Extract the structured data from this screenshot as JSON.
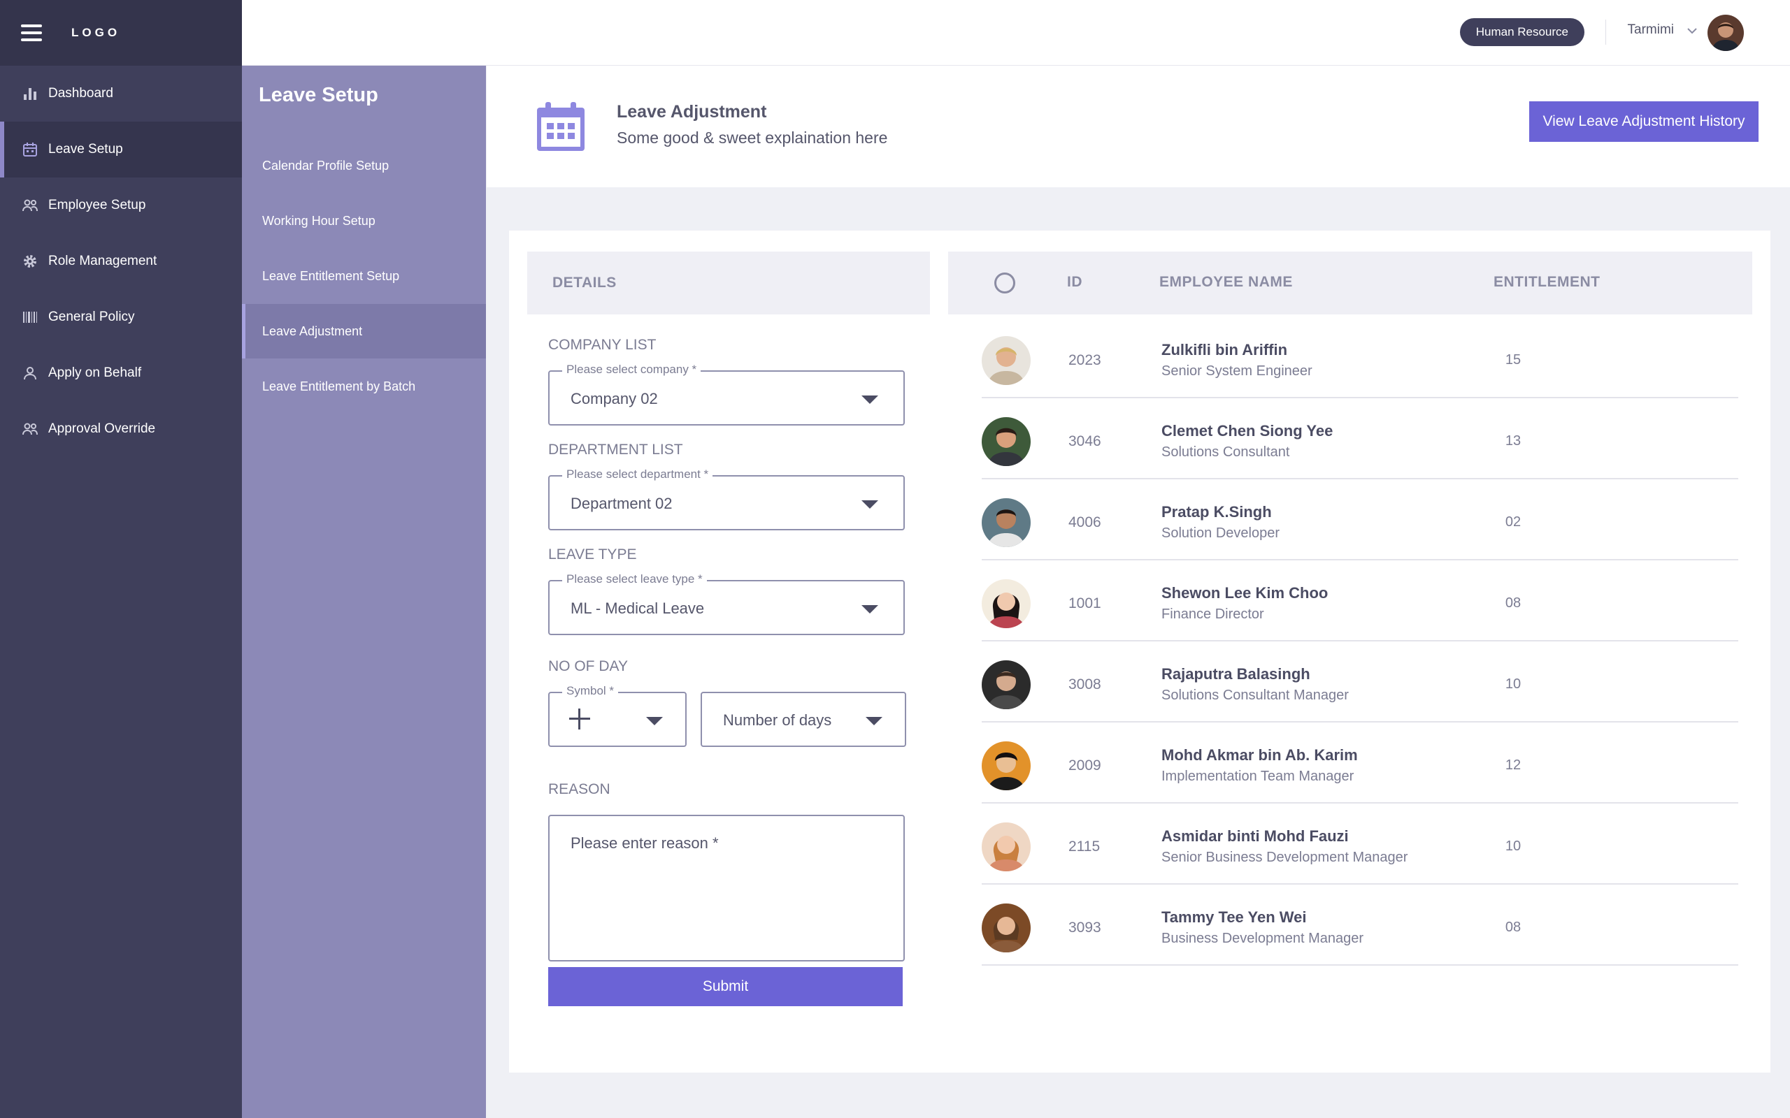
{
  "app": {
    "logo": "LOGO"
  },
  "sidebar": {
    "items": [
      {
        "label": "Dashboard",
        "icon": "bar-chart-icon"
      },
      {
        "label": "Leave Setup",
        "icon": "calendar-icon",
        "active": true
      },
      {
        "label": "Employee Setup",
        "icon": "users-icon"
      },
      {
        "label": "Role Management",
        "icon": "gear-icon"
      },
      {
        "label": "General Policy",
        "icon": "barcode-icon"
      },
      {
        "label": "Apply on Behalf",
        "icon": "user-icon"
      },
      {
        "label": "Approval Override",
        "icon": "users-icon"
      }
    ]
  },
  "subsidebar": {
    "title": "Leave Setup",
    "items": [
      {
        "label": "Calendar Profile Setup"
      },
      {
        "label": "Working Hour Setup"
      },
      {
        "label": "Leave Entitlement Setup"
      },
      {
        "label": "Leave Adjustment",
        "active": true
      },
      {
        "label": "Leave Entitlement by Batch"
      }
    ]
  },
  "header": {
    "role_badge": "Human Resource",
    "user_name": "Tarmimi"
  },
  "page": {
    "title": "Leave Adjustment",
    "subtitle": "Some good & sweet explaination here",
    "history_button": "View Leave Adjustment History"
  },
  "form": {
    "heading": "DETAILS",
    "company": {
      "section": "COMPANY LIST",
      "legend": "Please select company *",
      "value": "Company 02"
    },
    "department": {
      "section": "DEPARTMENT LIST",
      "legend": "Please select department *",
      "value": "Department 02"
    },
    "leave_type": {
      "section": "LEAVE TYPE",
      "legend": "Please select leave type *",
      "value": "ML - Medical Leave"
    },
    "no_of_day": {
      "section": "NO OF DAY",
      "symbol_legend": "Symbol *",
      "days_placeholder": "Number of days"
    },
    "reason": {
      "section": "REASON",
      "placeholder": "Please enter reason *"
    },
    "submit": "Submit"
  },
  "table": {
    "headers": {
      "id": "ID",
      "name": "EMPLOYEE NAME",
      "entitlement": "ENTITLEMENT"
    },
    "rows": [
      {
        "id": "2023",
        "name": "Zulkifli bin Ariffin",
        "title": "Senior System Engineer",
        "entitlement": "15"
      },
      {
        "id": "3046",
        "name": "Clemet Chen Siong Yee",
        "title": "Solutions Consultant",
        "entitlement": "13"
      },
      {
        "id": "4006",
        "name": "Pratap K.Singh",
        "title": "Solution Developer",
        "entitlement": "02"
      },
      {
        "id": "1001",
        "name": "Shewon Lee Kim Choo",
        "title": "Finance Director",
        "entitlement": "08"
      },
      {
        "id": "3008",
        "name": "Rajaputra Balasingh",
        "title": "Solutions Consultant Manager",
        "entitlement": "10"
      },
      {
        "id": "2009",
        "name": "Mohd Akmar bin Ab. Karim",
        "title": "Implementation Team Manager",
        "entitlement": "12"
      },
      {
        "id": "2115",
        "name": "Asmidar binti Mohd Fauzi",
        "title": "Senior Business Development Manager",
        "entitlement": "10"
      },
      {
        "id": "3093",
        "name": "Tammy Tee Yen Wei",
        "title": "Business Development Manager",
        "entitlement": "08"
      }
    ]
  },
  "colors": {
    "sidebar_bg": "#3f3f5b",
    "subsidebar_bg": "#8c89b7",
    "accent": "#6b63d6",
    "page_bg": "#eff0f5"
  }
}
